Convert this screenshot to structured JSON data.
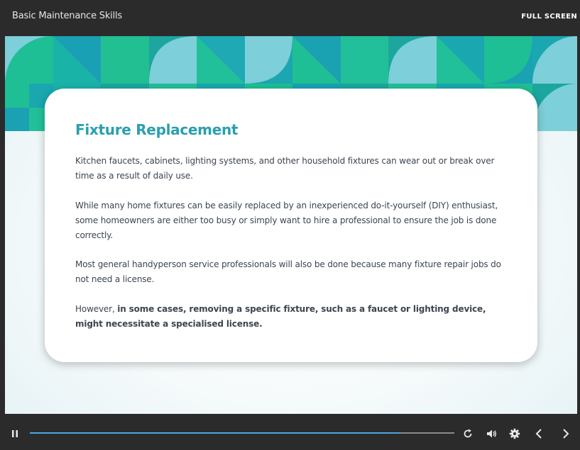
{
  "header": {
    "course_title": "Basic Maintenance Skills",
    "fullscreen_label": "FULL SCREEN"
  },
  "slide": {
    "title": "Fixture Replacement",
    "paragraph_1": "Kitchen faucets, cabinets, lighting systems, and other household fixtures can wear out or break over time as a result of daily use.",
    "paragraph_2": "While many home fixtures can be easily replaced by an inexperienced do-it-yourself (DIY) enthusiast, some homeowners are either too busy or simply want to hire a professional to ensure the job is done correctly.",
    "paragraph_3": "Most general handyperson service professionals will also be done because many fixture repair jobs do not need a license.",
    "paragraph_4_prefix": "However, ",
    "paragraph_4_bold": "in some cases, removing a specific fixture, such as a faucet or lighting device, might necessitate a specialised license."
  },
  "player": {
    "progress": 0.87,
    "icons": [
      "pause-icon",
      "replay-icon",
      "volume-icon",
      "settings-icon",
      "chevron-left-icon",
      "chevron-right-icon"
    ]
  },
  "colors": {
    "accent": "#2a9faf",
    "progress": "#4aa8e0",
    "teal_dark": "#189a9c",
    "teal_green": "#1fbf8f",
    "teal_light": "#80d0dc"
  }
}
